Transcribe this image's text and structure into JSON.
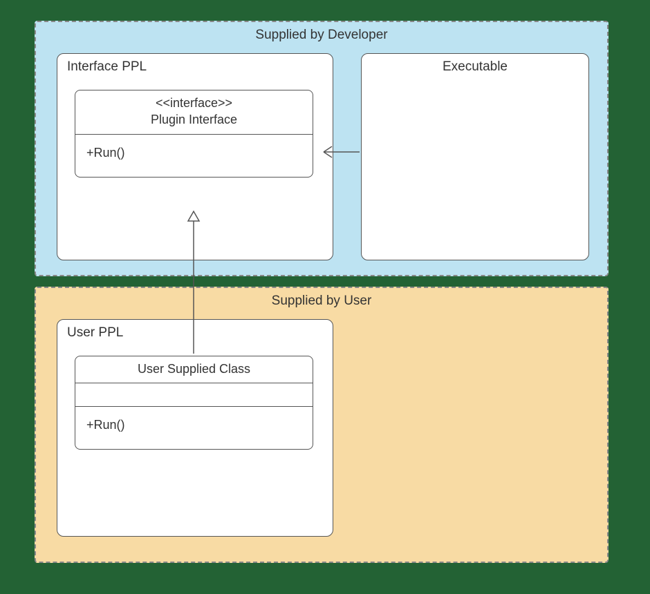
{
  "regions": {
    "developer": {
      "title": "Supplied by Developer"
    },
    "user": {
      "title": "Supplied by User"
    }
  },
  "packages": {
    "interface_ppl": {
      "title": "Interface PPL"
    },
    "executable": {
      "title": "Executable"
    },
    "user_ppl": {
      "title": "User PPL"
    }
  },
  "classes": {
    "plugin_interface": {
      "stereotype": "<<interface>>",
      "name": "Plugin Interface",
      "operations": [
        "+Run()"
      ]
    },
    "user_supplied": {
      "name": "User Supplied Class",
      "operations": [
        "+Run()"
      ]
    }
  },
  "relationships": [
    {
      "from": "executable",
      "to": "plugin_interface",
      "type": "dependency",
      "style": "open-arrow"
    },
    {
      "from": "user_supplied",
      "to": "plugin_interface",
      "type": "realization",
      "style": "hollow-triangle"
    }
  ]
}
